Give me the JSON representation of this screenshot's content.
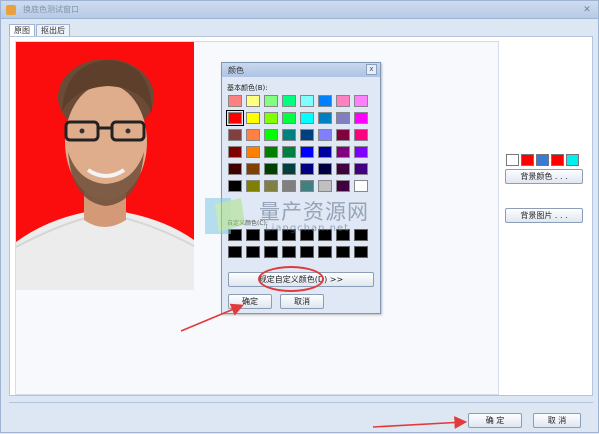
{
  "window": {
    "title": "换底色测试窗口"
  },
  "tabs": [
    "原图",
    "抠出后"
  ],
  "side": {
    "swatches": [
      "#ffffff",
      "#ff0000",
      "#3a7bd5",
      "#ff0000",
      "#00f0f0"
    ],
    "bgcolor_label": "背景颜色 . . .",
    "bgimg_label": "背景图片 . . ."
  },
  "footer": {
    "ok": "确  定",
    "cancel": "取  消"
  },
  "dialog": {
    "title": "颜色",
    "close": "x",
    "basic_label": "基本颜色(B):",
    "basic_colors": [
      "#ff8080",
      "#ffff80",
      "#80ff80",
      "#00ff80",
      "#80ffff",
      "#0080ff",
      "#ff80c0",
      "#ff80ff",
      "#ff0000",
      "#ffff00",
      "#80ff00",
      "#00ff40",
      "#00ffff",
      "#0080c0",
      "#8080c0",
      "#ff00ff",
      "#804040",
      "#ff8040",
      "#00ff00",
      "#008080",
      "#004080",
      "#8080ff",
      "#800040",
      "#ff0080",
      "#800000",
      "#ff8000",
      "#008000",
      "#008040",
      "#0000ff",
      "#0000a0",
      "#800080",
      "#8000ff",
      "#400000",
      "#804000",
      "#004000",
      "#004040",
      "#000080",
      "#000040",
      "#400040",
      "#400080",
      "#000000",
      "#808000",
      "#808040",
      "#808080",
      "#408080",
      "#c0c0c0",
      "#400040",
      "#ffffff"
    ],
    "custom_label": "自定义颜色(C):",
    "custom_count": 16,
    "define_label": "规定自定义颜色(D) >>",
    "ok": "确定",
    "cancel": "取消"
  },
  "watermark": {
    "text": "量产资源网",
    "sub": "Liangchan.net"
  }
}
